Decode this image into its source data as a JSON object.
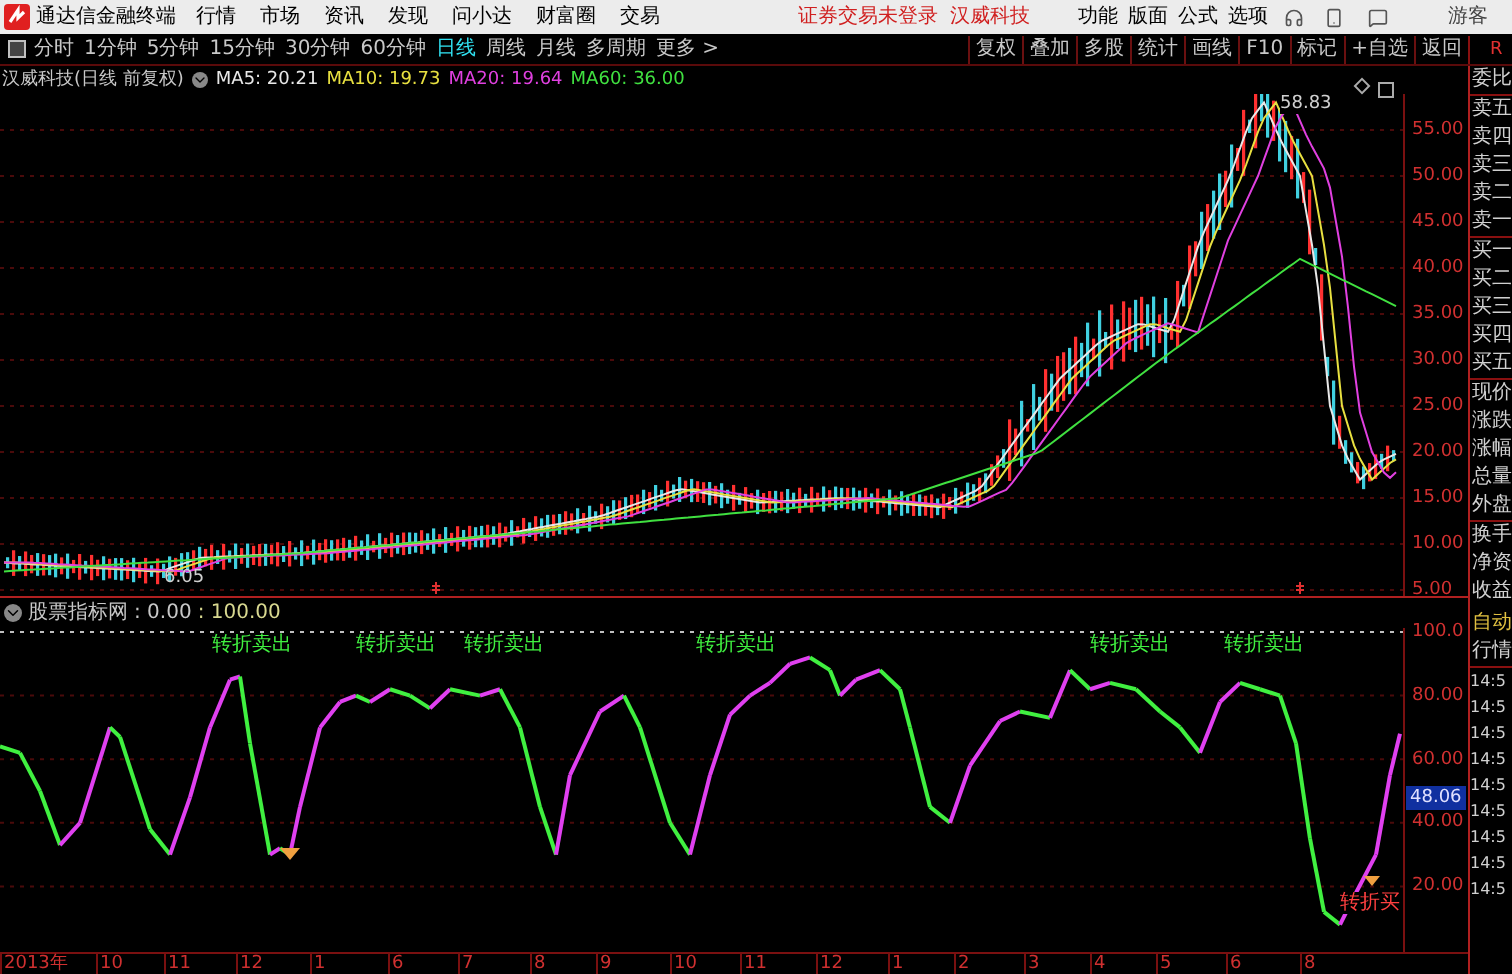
{
  "menu_bar": {
    "app_title": "通达信金融终端",
    "menus": [
      "行情",
      "市场",
      "资讯",
      "发现",
      "问小达",
      "财富圈",
      "交易"
    ],
    "login_status": "证券交易未登录",
    "stock_name": "汉威科技",
    "tools": [
      "功能",
      "版面",
      "公式",
      "选项"
    ],
    "user": "游客"
  },
  "period_tabs": [
    {
      "label": "分时",
      "selected": false
    },
    {
      "label": "1分钟",
      "selected": false
    },
    {
      "label": "5分钟",
      "selected": false
    },
    {
      "label": "15分钟",
      "selected": false
    },
    {
      "label": "30分钟",
      "selected": false
    },
    {
      "label": "60分钟",
      "selected": false
    },
    {
      "label": "日线",
      "selected": true
    },
    {
      "label": "周线",
      "selected": false
    },
    {
      "label": "月线",
      "selected": false
    },
    {
      "label": "多周期",
      "selected": false
    },
    {
      "label": "更多 >",
      "selected": false
    }
  ],
  "toolbar_buttons": [
    "复权",
    "叠加",
    "多股",
    "统计",
    "画线",
    "F10",
    "标记",
    "+自选",
    "返回"
  ],
  "panel_header": "R",
  "chart": {
    "title": "汉威科技(日线 前复权)",
    "ma": [
      {
        "label": "MA5: 20.21",
        "color": "#e8e8e8"
      },
      {
        "label": "MA10: 19.73",
        "color": "#e8e040"
      },
      {
        "label": "MA20: 19.64",
        "color": "#e040e0"
      },
      {
        "label": "MA60: 36.00",
        "color": "#40e040"
      }
    ],
    "high_label": "58.83",
    "low_label": "6.05",
    "price_axis": [
      "55.00",
      "50.00",
      "45.00",
      "40.00",
      "35.00",
      "30.00",
      "25.00",
      "20.00",
      "15.00",
      "10.00",
      "5.00"
    ]
  },
  "quote_panel": {
    "labels": [
      "委比",
      "卖五",
      "卖四",
      "卖三",
      "卖二",
      "卖一",
      "买一",
      "买二",
      "买三",
      "买四",
      "买五",
      "现价",
      "涨跌",
      "涨幅",
      "总量",
      "外盘",
      "换手",
      "净资",
      "收益"
    ],
    "auto_label": "自动",
    "quote_label": "行情",
    "ticks": [
      "14:5",
      "14:5",
      "14:5",
      "14:5",
      "14:5",
      "14:5",
      "14:5",
      "14:5",
      "14:5"
    ]
  },
  "indicator": {
    "name": "股票指标网",
    "min": ": 0.00",
    "max": ": 100.00",
    "axis": [
      "100.0",
      "80.00",
      "60.00",
      "40.00",
      "20.00"
    ],
    "current": "48.06",
    "signals": [
      {
        "label": "转折卖出",
        "kind": "sell"
      },
      {
        "label": "转折卖出",
        "kind": "sell"
      },
      {
        "label": "转折卖出",
        "kind": "sell"
      },
      {
        "label": "转折卖出",
        "kind": "sell"
      },
      {
        "label": "转折卖出",
        "kind": "sell"
      },
      {
        "label": "转折卖出",
        "kind": "sell"
      },
      {
        "label": "转折买",
        "kind": "buy"
      }
    ]
  },
  "time_axis": [
    "2013年",
    "10",
    "11",
    "12",
    "1",
    "6",
    "7",
    "8",
    "9",
    "10",
    "11",
    "12",
    "1",
    "2",
    "3",
    "4",
    "5",
    "6",
    "8"
  ]
}
